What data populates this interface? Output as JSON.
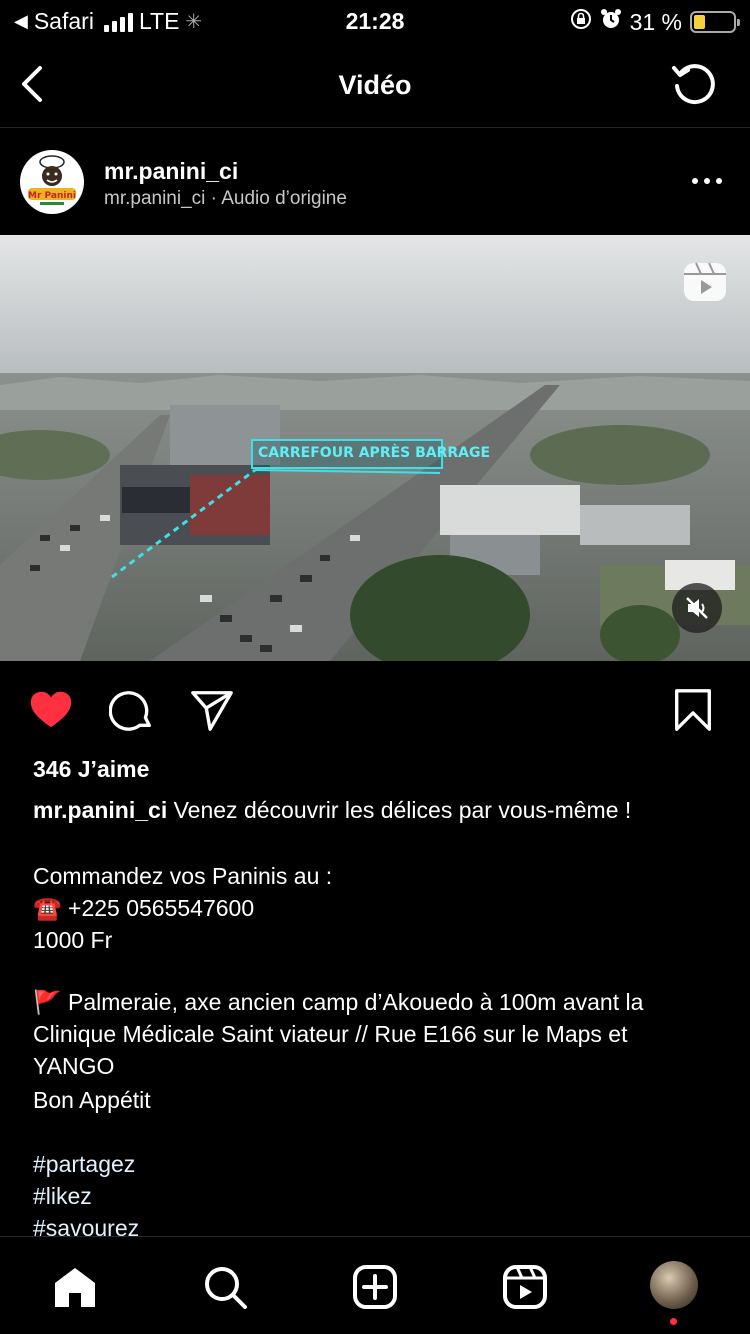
{
  "status_bar": {
    "back_app": "Safari",
    "network": "LTE",
    "time": "21:28",
    "battery": "31 %",
    "battery_level": 0.31
  },
  "nav": {
    "title": "Vidéo"
  },
  "post": {
    "username": "mr.panini_ci",
    "subline": "mr.panini_ci · Audio d’origine",
    "media_overlay_text": "CARREFOUR APRÈS BARRAGE",
    "likes": "346 J’aime",
    "caption": {
      "user": "mr.panini_ci",
      "text": " Venez découvrir les délices par vous-même !",
      "lines": [
        "Commandez vos Paninis au :",
        "☎️ +225 0565547600",
        "1000 Fr"
      ],
      "location_lines": [
        "🚩 Palmeraie, axe ancien camp d’Akouedo à 100m avant la",
        "Clinique Médicale Saint viateur // Rue E166 sur le Maps et",
        "YANGO",
        "Bon Appétit"
      ],
      "hashtags": [
        "#partagez",
        "#likez",
        "#savourez"
      ]
    }
  },
  "icons": {
    "like": "heart-icon",
    "comment": "comment-icon",
    "share": "send-icon",
    "save": "bookmark-icon"
  },
  "colors": {
    "accent_like": "#ff3040",
    "background": "#000000",
    "overlay_cyan": "#3ee0e8"
  }
}
